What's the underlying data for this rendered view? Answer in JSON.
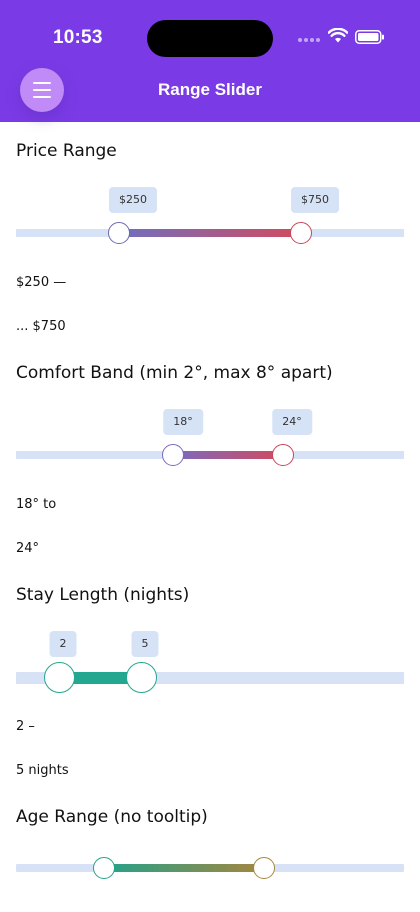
{
  "status_bar": {
    "time": "10:53"
  },
  "header": {
    "title": "Range Slider",
    "menu_icon": "hamburger-icon"
  },
  "sliders": [
    {
      "title": "Price Range",
      "min_value": 250,
      "max_value": 750,
      "min_label": "$250",
      "max_label": "$750",
      "line1": "$250 —",
      "line2": "... $750",
      "colors": [
        "#6f6fbf",
        "#d24a5f"
      ]
    },
    {
      "title": "Comfort Band (min 2°, max 8° apart)",
      "min_value": 18,
      "max_value": 24,
      "min_label": "18°",
      "max_label": "24°",
      "line1": "18° to",
      "line2": "24°",
      "colors": [
        "#7a6abf",
        "#d24a5f"
      ]
    },
    {
      "title": "Stay Length (nights)",
      "min_value": 2,
      "max_value": 5,
      "min_label": "2",
      "max_label": "5",
      "line1": "2 –",
      "line2": "5 nights",
      "colors": [
        "#22a890",
        "#22a890"
      ]
    },
    {
      "title": "Age Range (no tooltip)",
      "colors": [
        "#22a28a",
        "#a6853e"
      ]
    }
  ]
}
